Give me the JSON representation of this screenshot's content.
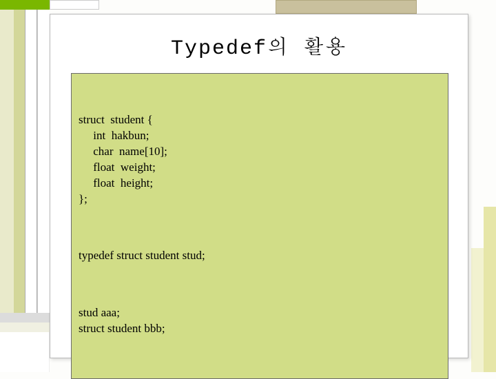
{
  "title": "Typedef의 활용",
  "code": {
    "struct_decl": "struct  student {\n     int  hakbun;\n     char  name[10];\n     float  weight;\n     float  height;\n};",
    "typedef_line": "typedef struct student stud;",
    "usage": "stud aaa;\nstruct student bbb;"
  }
}
